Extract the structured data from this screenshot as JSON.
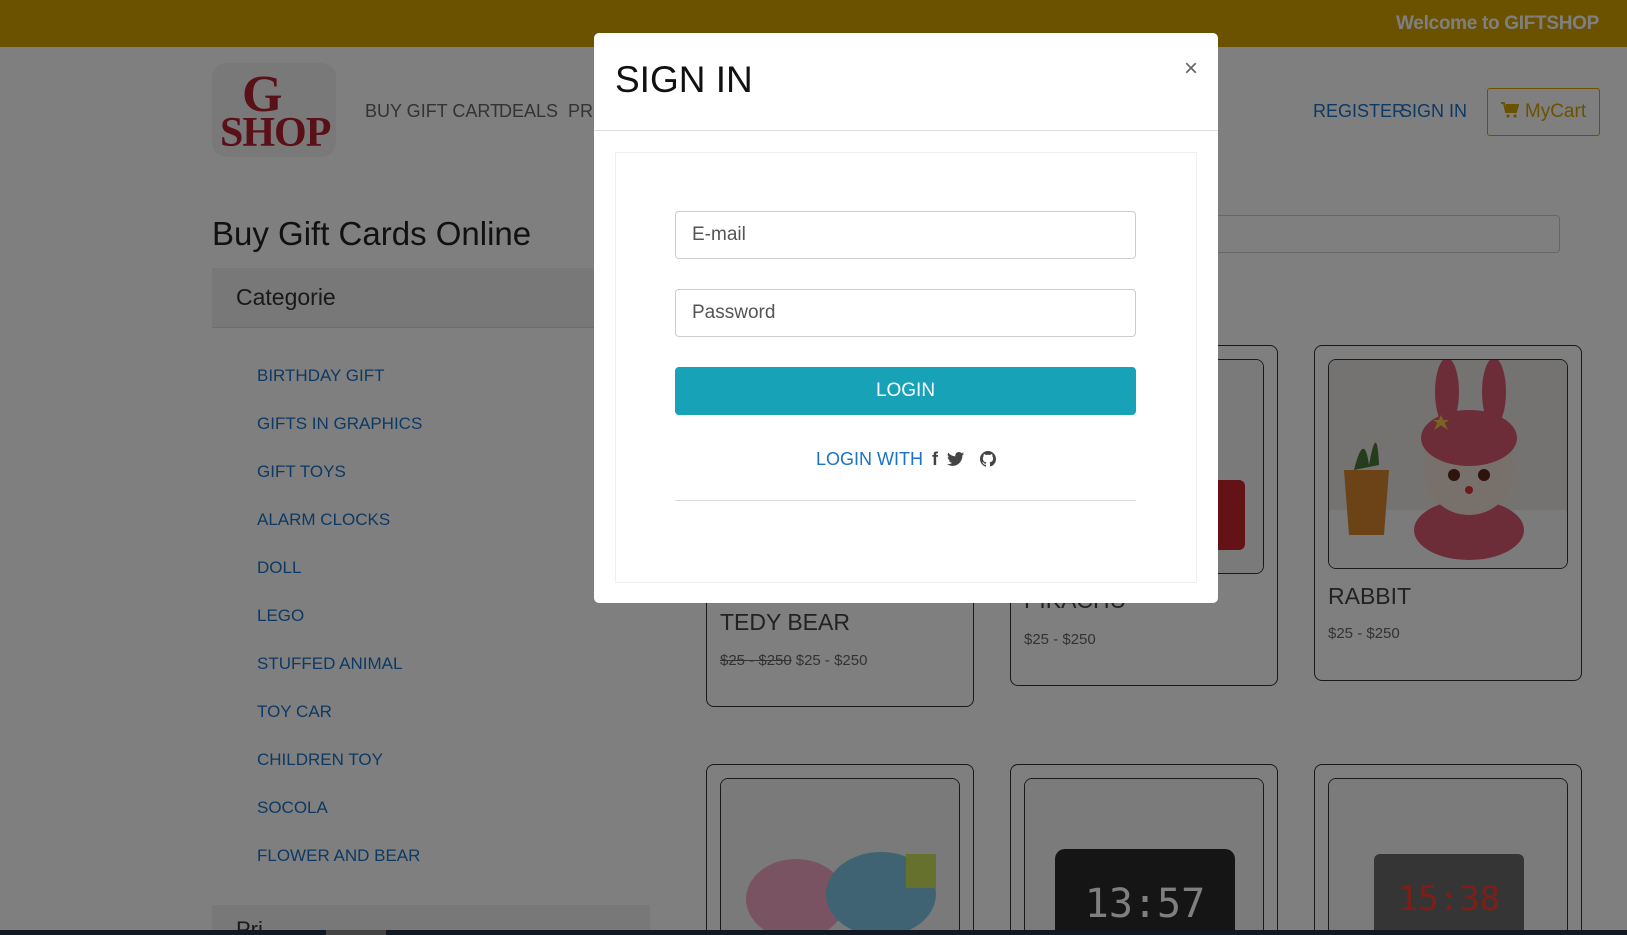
{
  "topbar": {
    "welcome": "Welcome to GIFTSHOP"
  },
  "header": {
    "logo": {
      "line1": "G",
      "line2": "SHOP"
    },
    "nav": [
      "BUY GIFT CART",
      "DEALS",
      "PR"
    ],
    "register": "REGISTER",
    "sign_in": "SIGN IN",
    "cart": "MyCart"
  },
  "page": {
    "title": "Buy Gift Cards Online"
  },
  "sidebar": {
    "title": "Categorie",
    "categories": [
      "BIRTHDAY GIFT",
      "GIFTS IN GRAPHICS",
      "GIFT TOYS",
      "ALARM CLOCKS",
      "DOLL",
      "LEGO",
      "STUFFED ANIMAL",
      "TOY CAR",
      "CHILDREN TOY",
      "SOCOLA",
      "FLOWER AND BEAR"
    ],
    "price_title": "Pri"
  },
  "products": [
    {
      "name": "TEDY BEAR",
      "old_price": "$25 - $250",
      "price": "$25 - $250"
    },
    {
      "name": "PIKACHU",
      "price": "$25 - $250"
    },
    {
      "name": "RABBIT",
      "price": "$25 - $250"
    }
  ],
  "clock_displays": [
    "13:57",
    "15:38"
  ],
  "modal": {
    "title": "SIGN IN",
    "close": "×",
    "email_placeholder": "E-mail",
    "password_placeholder": "Password",
    "login_button": "LOGIN",
    "login_with": "LOGIN WITH",
    "facebook_glyph": "f"
  },
  "colors": {
    "accent": "#d6a400",
    "link": "#1a73c8",
    "button": "#17a2b8"
  }
}
